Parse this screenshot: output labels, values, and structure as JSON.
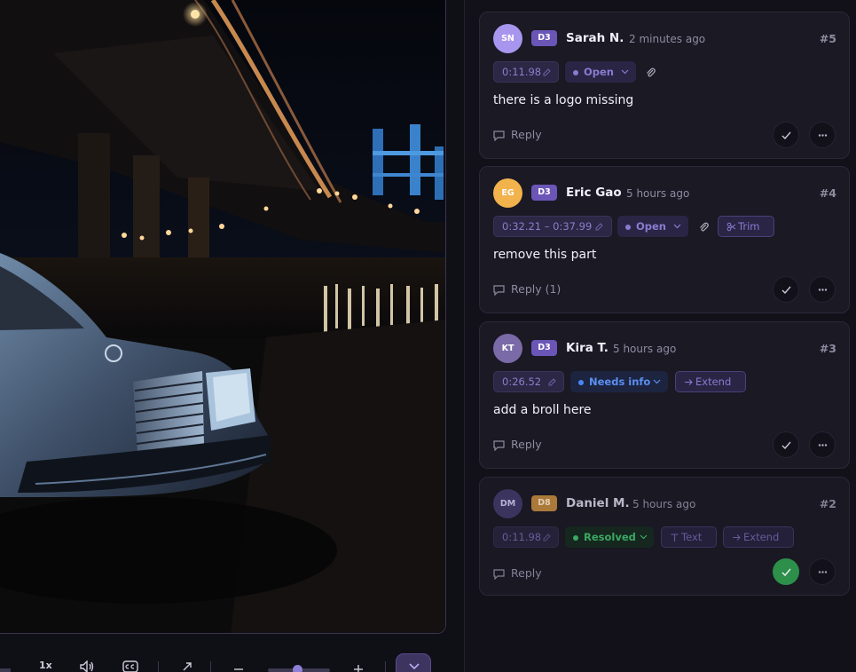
{
  "player": {
    "speed_label": "1x",
    "icons": [
      "volume-icon",
      "captions-icon",
      "expand-icon",
      "zoom-out-icon",
      "zoom-in-icon",
      "chevron-down-icon"
    ]
  },
  "comments": [
    {
      "initials": "SN",
      "avatar_color": "#a896ee",
      "dept": "D3",
      "dept_color": "#6b56b8",
      "name": "Sarah N.",
      "time": "2 minutes ago",
      "number": "#5",
      "timecode": "0:11.98",
      "status": "Open",
      "has_attachment": true,
      "actions": [],
      "text": "there is a logo missing",
      "reply_label": "Reply",
      "resolved": false
    },
    {
      "initials": "EG",
      "avatar_color": "#f2b24c",
      "dept": "D3",
      "dept_color": "#6b56b8",
      "name": "Eric Gao",
      "time": "5 hours ago",
      "number": "#4",
      "timecode": "0:32.21 – 0:37.99",
      "status": "Open",
      "has_attachment": true,
      "actions": [
        "Trim"
      ],
      "text": "remove this part",
      "reply_label": "Reply (1)",
      "resolved": false
    },
    {
      "initials": "KT",
      "avatar_color": "#7a6aa8",
      "dept": "D3",
      "dept_color": "#6b56b8",
      "name": "Kira T.",
      "time": "5 hours ago",
      "number": "#3",
      "timecode": "0:26.52",
      "status": "Needs info",
      "has_attachment": false,
      "actions": [
        "Extend"
      ],
      "text": "add a broll here",
      "reply_label": "Reply",
      "resolved": false
    },
    {
      "initials": "DM",
      "avatar_color": "#3f3866",
      "dept": "D8",
      "dept_color": "#b8823c",
      "name": "Daniel M.",
      "time": "5 hours ago",
      "number": "#2",
      "timecode": "0:11.98",
      "status": "Resolved",
      "has_attachment": false,
      "actions": [
        "Text",
        "Extend"
      ],
      "text": "",
      "reply_label": "Reply",
      "resolved": true
    }
  ]
}
